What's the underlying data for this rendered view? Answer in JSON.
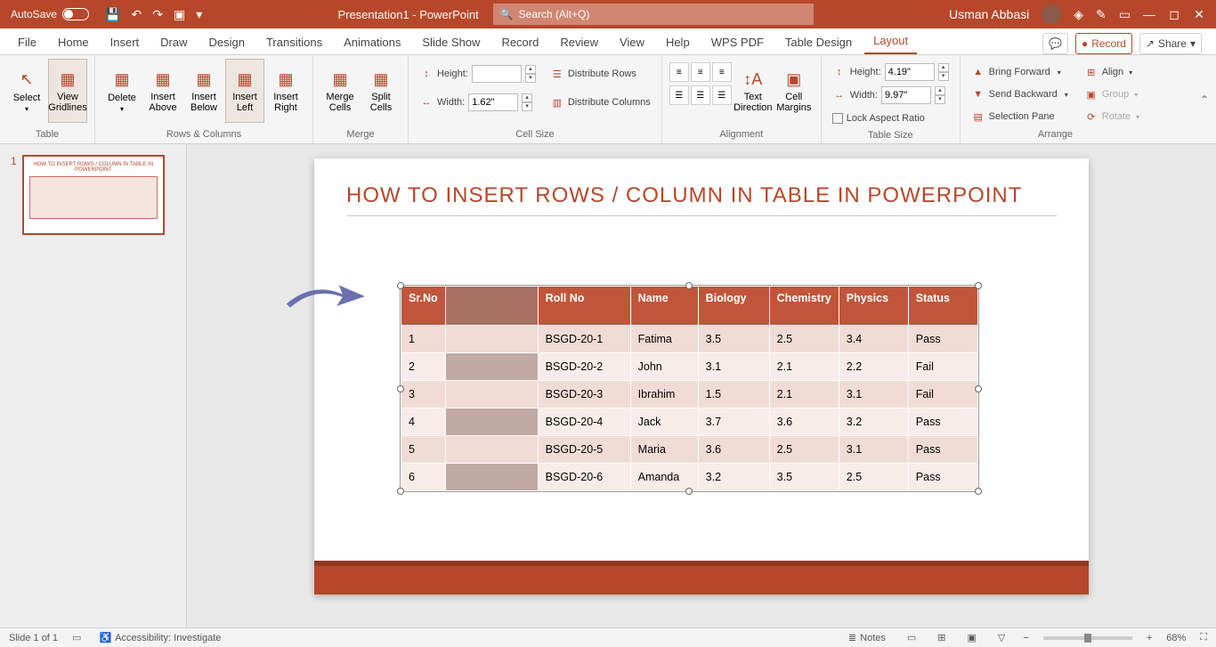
{
  "titlebar": {
    "autosave": "AutoSave",
    "doc_title": "Presentation1 - PowerPoint",
    "search_placeholder": "Search (Alt+Q)",
    "user": "Usman Abbasi"
  },
  "tabs": {
    "file": "File",
    "home": "Home",
    "insert": "Insert",
    "draw": "Draw",
    "design": "Design",
    "transitions": "Transitions",
    "animations": "Animations",
    "slideshow": "Slide Show",
    "record_tab": "Record",
    "review": "Review",
    "view": "View",
    "help": "Help",
    "wps": "WPS PDF",
    "table_design": "Table Design",
    "layout": "Layout",
    "record_btn": "Record",
    "share": "Share"
  },
  "ribbon": {
    "table": {
      "select": "Select",
      "gridlines": "View\nGridlines",
      "label": "Table"
    },
    "rc": {
      "delete": "Delete",
      "above": "Insert\nAbove",
      "below": "Insert\nBelow",
      "left": "Insert\nLeft",
      "right": "Insert\nRight",
      "label": "Rows & Columns"
    },
    "merge": {
      "merge": "Merge\nCells",
      "split": "Split\nCells",
      "label": "Merge"
    },
    "cellsize": {
      "height": "Height:",
      "width": "Width:",
      "height_val": "",
      "width_val": "1.62\"",
      "dist_rows": "Distribute Rows",
      "dist_cols": "Distribute Columns",
      "label": "Cell Size"
    },
    "alignment": {
      "text_dir": "Text\nDirection",
      "margins": "Cell\nMargins",
      "label": "Alignment"
    },
    "tablesize": {
      "height": "Height:",
      "width": "Width:",
      "height_val": "4.19\"",
      "width_val": "9.97\"",
      "lock": "Lock Aspect Ratio",
      "label": "Table Size"
    },
    "arrange": {
      "forward": "Bring Forward",
      "backward": "Send Backward",
      "selpane": "Selection Pane",
      "align": "Align",
      "group": "Group",
      "rotate": "Rotate",
      "label": "Arrange"
    }
  },
  "slide": {
    "title": "HOW TO INSERT ROWS / COLUMN IN TABLE IN POWERPOINT",
    "headers": [
      "Sr.No",
      "",
      "Roll No",
      "Name",
      "Biology",
      "Chemistry",
      "Physics",
      "Status"
    ],
    "rows": [
      [
        "1",
        "",
        "BSGD-20-1",
        "Fatima",
        "3.5",
        "2.5",
        "3.4",
        "Pass"
      ],
      [
        "2",
        "",
        "BSGD-20-2",
        "John",
        "3.1",
        "2.1",
        "2.2",
        "Fail"
      ],
      [
        "3",
        "",
        "BSGD-20-3",
        "Ibrahim",
        "1.5",
        "2.1",
        "3.1",
        "Fail"
      ],
      [
        "4",
        "",
        "BSGD-20-4",
        "Jack",
        "3.7",
        "3.6",
        "3.2",
        "Pass"
      ],
      [
        "5",
        "",
        "BSGD-20-5",
        "Maria",
        "3.6",
        "2.5",
        "3.1",
        "Pass"
      ],
      [
        "6",
        "",
        "BSGD-20-6",
        "Amanda",
        "3.2",
        "3.5",
        "2.5",
        "Pass"
      ]
    ],
    "col_widths": [
      "48px",
      "104px",
      "104px",
      "76px",
      "80px",
      "74px",
      "78px",
      "78px"
    ]
  },
  "status": {
    "slide": "Slide 1 of 1",
    "accessibility": "Accessibility: Investigate",
    "notes": "Notes",
    "zoom": "68%"
  },
  "thumb_num": "1"
}
